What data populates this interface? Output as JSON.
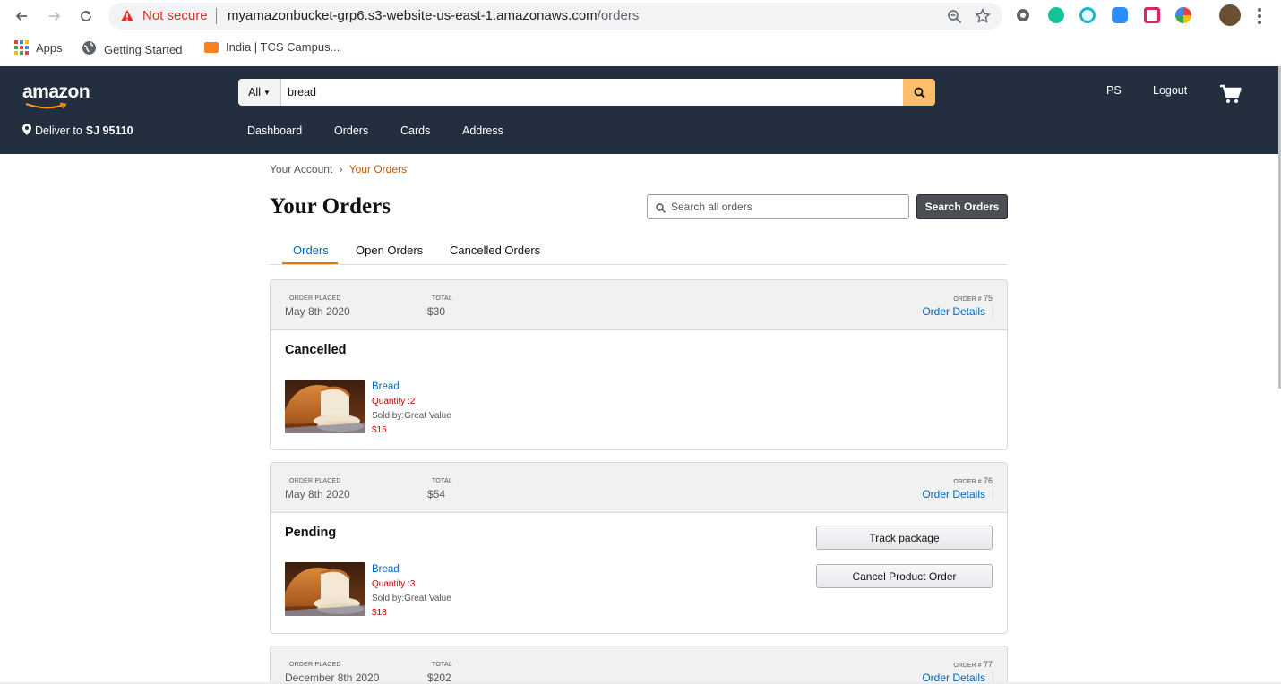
{
  "browser": {
    "not_secure": "Not secure",
    "url_host": "myamazonbucket-grp6.s3-website-us-east-1.amazonaws.com",
    "url_path": "/orders",
    "bookmarks": [
      {
        "label": "Apps"
      },
      {
        "label": "Getting Started"
      },
      {
        "label": "India | TCS Campus..."
      }
    ]
  },
  "header": {
    "logo": "amazon",
    "deliver_prefix": "Deliver to",
    "deliver_location": "SJ 95110",
    "search_category": "All",
    "search_value": "bread",
    "user_initials": "PS",
    "logout_label": "Logout",
    "nav": [
      "Dashboard",
      "Orders",
      "Cards",
      "Address"
    ]
  },
  "page": {
    "breadcrumb": {
      "parent": "Your Account",
      "separator": "›",
      "current": "Your Orders"
    },
    "title": "Your Orders",
    "search_placeholder": "Search all orders",
    "search_button": "Search Orders",
    "tabs": [
      "Orders",
      "Open Orders",
      "Cancelled Orders"
    ],
    "active_tab": "Orders"
  },
  "order_labels": {
    "placed": "ORDER PLACED",
    "total": "TOTAL",
    "order_no": "ORDER #",
    "details": "Order Details"
  },
  "orders": [
    {
      "placed": "May 8th 2020",
      "total": "$30",
      "number": "75",
      "status": "Cancelled",
      "item": {
        "name": "Bread",
        "quantity": "Quantity :2",
        "sold_by": "Sold by:Great Value",
        "price": "$15"
      }
    },
    {
      "placed": "May 8th 2020",
      "total": "$54",
      "number": "76",
      "status": "Pending",
      "actions": [
        "Track package",
        "Cancel Product Order"
      ],
      "item": {
        "name": "Bread",
        "quantity": "Quantity :3",
        "sold_by": "Sold by:Great Value",
        "price": "$18"
      }
    },
    {
      "placed": "December 8th 2020",
      "total": "$202",
      "number": "77"
    }
  ],
  "colors": {
    "header_bg": "#232f3e",
    "search_button": "#febd69",
    "link": "#0066c0",
    "accent_orange": "#c45500",
    "price_red": "#c40000"
  }
}
